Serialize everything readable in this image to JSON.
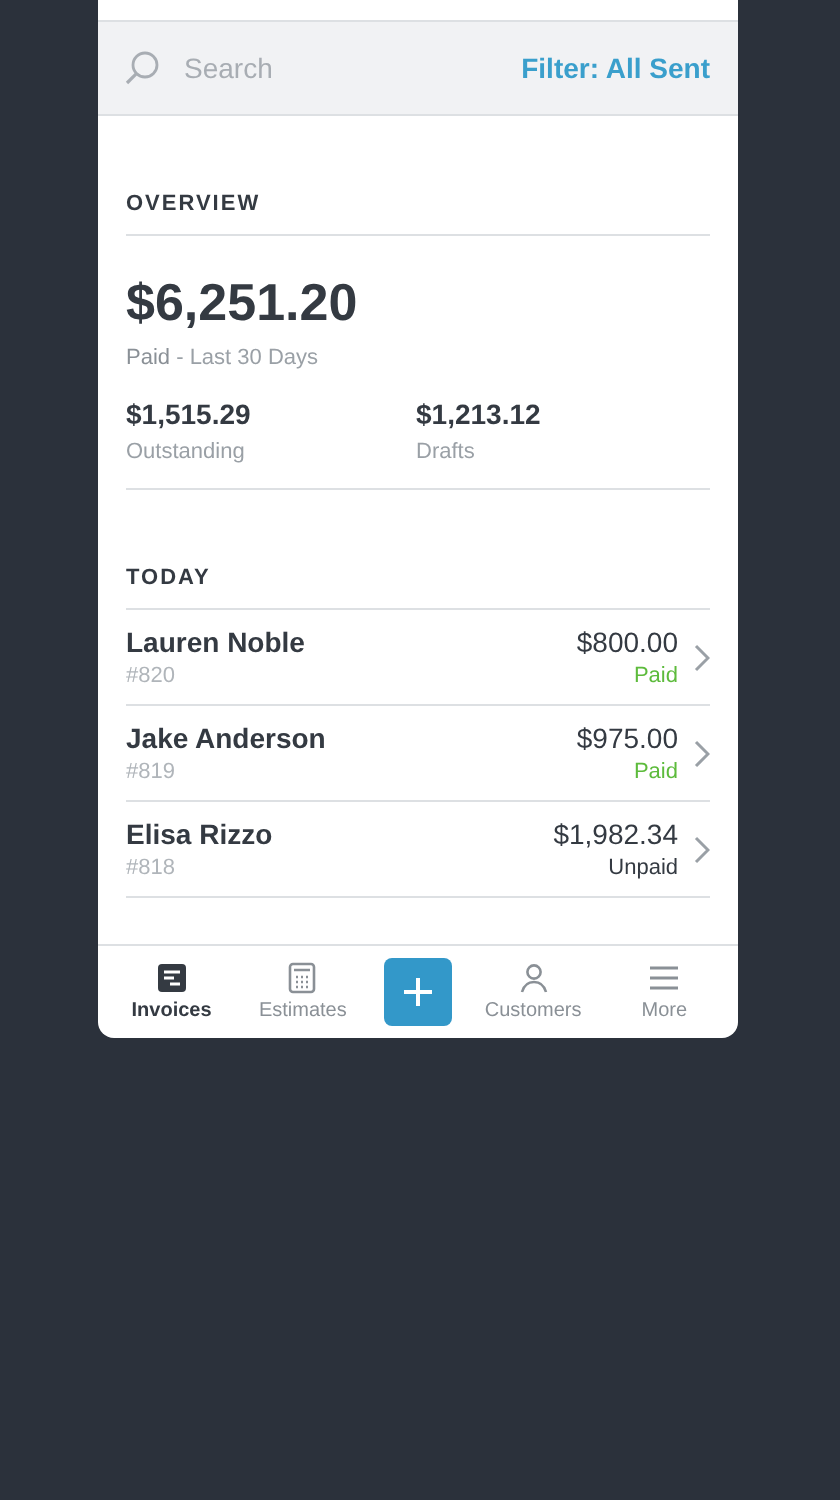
{
  "search": {
    "placeholder": "Search",
    "filter": "Filter: All Sent"
  },
  "overview": {
    "heading": "OVERVIEW",
    "total": "$6,251.20",
    "total_label": "Paid",
    "total_period": "- Last 30 Days",
    "stats": [
      {
        "value": "$1,515.29",
        "label": "Outstanding"
      },
      {
        "value": "$1,213.12",
        "label": "Drafts"
      }
    ]
  },
  "today": {
    "heading": "TODAY",
    "invoices": [
      {
        "name": "Lauren Noble",
        "number": "#820",
        "amount": "$800.00",
        "status": "Paid",
        "kind": "paid"
      },
      {
        "name": "Jake Anderson",
        "number": "#819",
        "amount": "$975.00",
        "status": "Paid",
        "kind": "paid"
      },
      {
        "name": "Elisa Rizzo",
        "number": "#818",
        "amount": "$1,982.34",
        "status": "Unpaid",
        "kind": "unpaid"
      }
    ]
  },
  "tab_bar": [
    {
      "kind": "invoices",
      "label": "Invoices",
      "selected": true
    },
    {
      "kind": "estimates",
      "label": "Estimates",
      "selected": false
    },
    {
      "kind": "add"
    },
    {
      "kind": "customers",
      "label": "Customers",
      "selected": false
    },
    {
      "kind": "more",
      "label": "More",
      "selected": false
    }
  ]
}
